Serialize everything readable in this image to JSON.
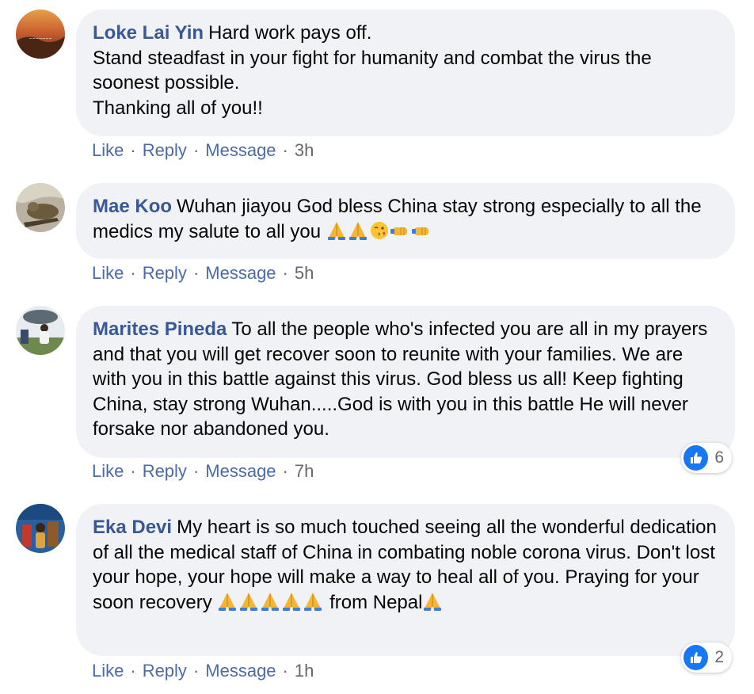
{
  "comments": [
    {
      "author": "Loke Lai Yin",
      "text": "Hard work pays off.\nStand steadfast in your fight for humanity and combat the virus the soonest possible.\nThanking all of you!!",
      "trailing_emojis": [],
      "after_emoji_text": "",
      "like": "Like",
      "reply": "Reply",
      "message": "Message",
      "time": "3h",
      "reactions": null
    },
    {
      "author": "Mae Koo",
      "text": "Wuhan jiayou God bless China stay strong especially to all the medics my salute to all you ",
      "trailing_emojis": [
        "folded-hands-emoji",
        "folded-hands-emoji",
        "kissing-face-emoji",
        "right-fist-emoji",
        "right-fist-emoji"
      ],
      "after_emoji_text": "",
      "like": "Like",
      "reply": "Reply",
      "message": "Message",
      "time": "5h",
      "reactions": null
    },
    {
      "author": "Marites Pineda",
      "text": "To all the people who's infected you are all in my prayers and that you will get recover soon to reunite with your families. We are with you in this battle against this virus. God bless us all! Keep fighting China, stay strong Wuhan.....God is with you in this battle He will never forsake nor abandoned you.",
      "trailing_emojis": [],
      "after_emoji_text": "",
      "like": "Like",
      "reply": "Reply",
      "message": "Message",
      "time": "7h",
      "reactions": "6"
    },
    {
      "author": "Eka Devi",
      "text": "My heart is so much touched seeing all the wonderful dedication of all the medical staff of China in combating noble corona virus. Don't lost your hope, your hope will make a way to heal all of you. Praying for your soon recovery ",
      "trailing_emojis": [
        "folded-hands-emoji",
        "folded-hands-emoji",
        "folded-hands-emoji",
        "folded-hands-emoji",
        "folded-hands-emoji"
      ],
      "after_emoji_text": " from Nepal",
      "final_emoji": "folded-hands-emoji",
      "like": "Like",
      "reply": "Reply",
      "message": "Message",
      "time": "1h",
      "reactions": "2"
    }
  ],
  "colors": {
    "author": "#385898",
    "bubble": "#f0f2f5",
    "action_link": "#4b6aa8",
    "meta": "#65676b",
    "like_blue": "#1877f2"
  }
}
